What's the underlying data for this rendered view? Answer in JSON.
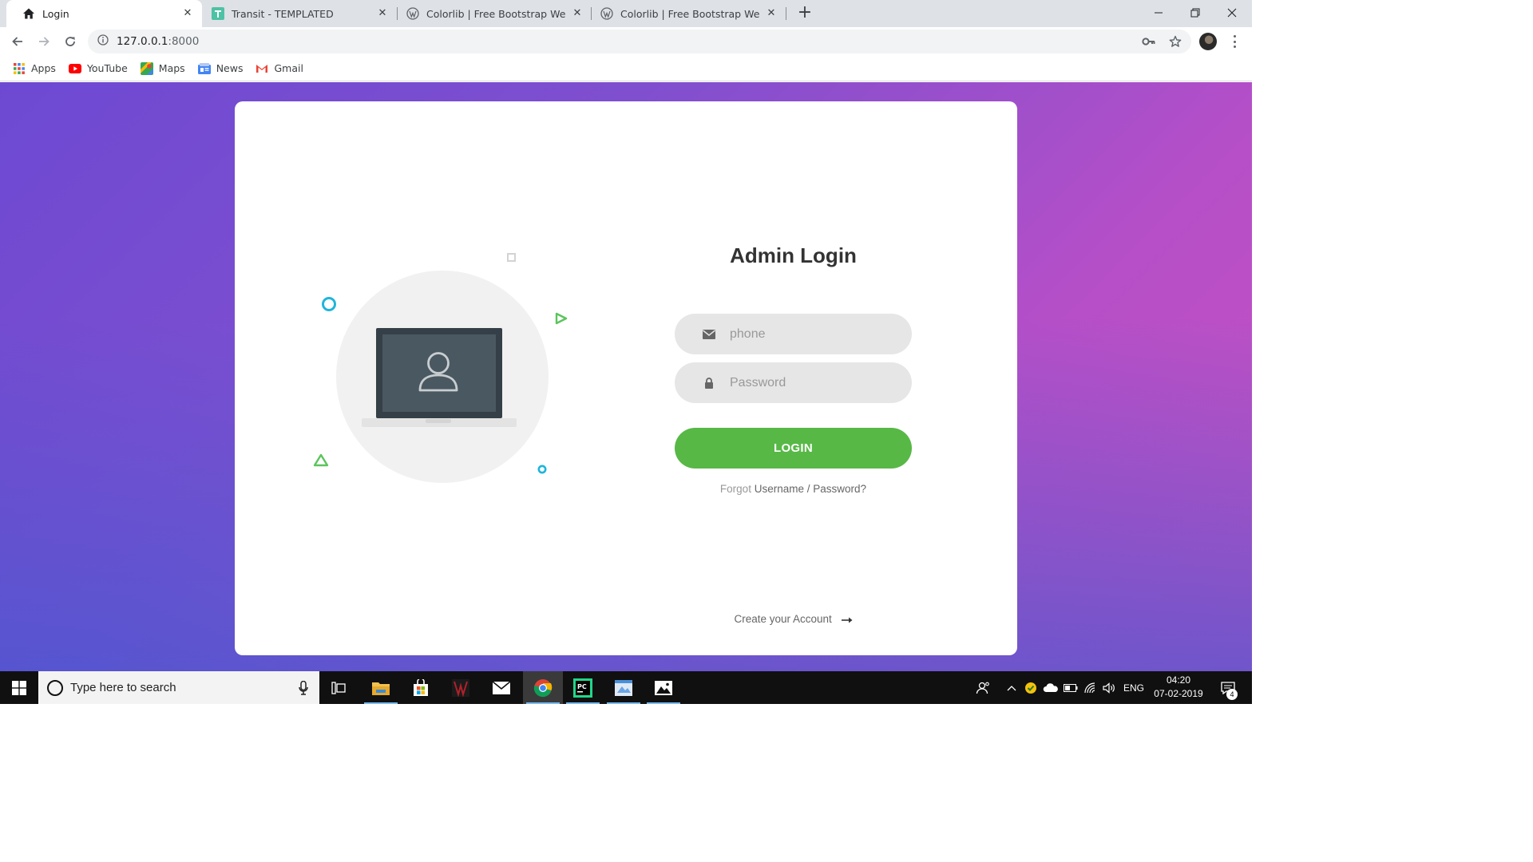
{
  "browser": {
    "tabs": [
      {
        "label": "Login",
        "favicon": "home-icon",
        "active": true
      },
      {
        "label": "Transit - TEMPLATED",
        "favicon": "templated-t-icon",
        "active": false
      },
      {
        "label": "Colorlib | Free Bootstrap Website",
        "favicon": "wordpress-icon",
        "active": false
      },
      {
        "label": "Colorlib | Free Bootstrap Website",
        "favicon": "wordpress-icon",
        "active": false
      }
    ],
    "new_tab_label": "+",
    "url_host": "127.0.0.1",
    "url_port": ":8000",
    "bookmarks": [
      {
        "label": "Apps",
        "icon": "apps-grid-icon"
      },
      {
        "label": "YouTube",
        "icon": "youtube-icon"
      },
      {
        "label": "Maps",
        "icon": "maps-icon"
      },
      {
        "label": "News",
        "icon": "news-icon"
      },
      {
        "label": "Gmail",
        "icon": "gmail-icon"
      }
    ]
  },
  "login": {
    "title": "Admin Login",
    "phone_placeholder": "phone",
    "password_placeholder": "Password",
    "login_button": "LOGIN",
    "forgot_prefix": "Forgot",
    "forgot_username": "Username",
    "forgot_separator": " / ",
    "forgot_password": "Password?",
    "create_account": "Create your Account",
    "colors": {
      "button": "#57b846",
      "field": "#e6e6e6",
      "gradient_start": "#6d49d2",
      "gradient_end": "#c850c0",
      "gradient_bottom": "#4158d0"
    }
  },
  "taskbar": {
    "search_placeholder": "Type here to search",
    "language": "ENG",
    "time": "04:20",
    "date": "07-02-2019",
    "notification_count": "4",
    "apps": [
      "file-explorer-icon",
      "store-icon",
      "game-app-icon",
      "mail-icon",
      "chrome-icon",
      "pycharm-icon",
      "paint-icon",
      "photos-icon"
    ]
  }
}
